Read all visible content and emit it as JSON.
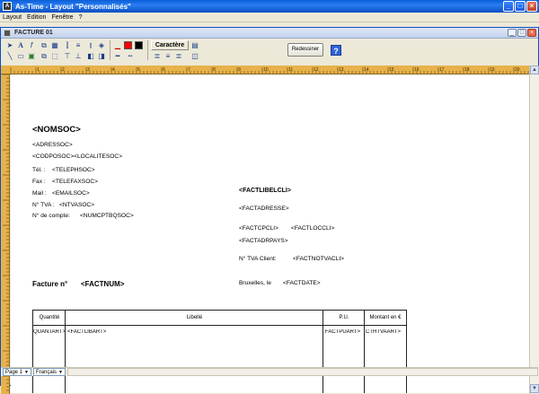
{
  "app": {
    "title": "As-Time - Layout \"Personnalisés\""
  },
  "menu": [
    "Layout",
    "Edition",
    "Fenêtre",
    "?"
  ],
  "child": {
    "title": "FACTURE 01"
  },
  "toolbar": {
    "caractere": "Caractère",
    "redessiner": "Redessiner",
    "help": "?"
  },
  "swatches": [
    "#ff0000",
    "#000000"
  ],
  "doc": {
    "nomsoc": "<NOMSOC>",
    "adressoc": "<ADRESSOC>",
    "codposoc": "<CODPOSOC><LOCALITESOC>",
    "tel_label": "Tél. :",
    "tel_value": "<TELEPHSOC>",
    "fax_label": "Fax :",
    "fax_value": "<TELEFAXSOC>",
    "mail_label": "Mail :",
    "mail_value": "<EMAILSOC>",
    "tva_label": "N° TVA :",
    "tva_value": "<NTVASOC>",
    "compte_label": "N° de compte:",
    "compte_value": "<NUMCPTBQSOC>",
    "factlibelcli": "<FACTLIBELCLI>",
    "factadresse": "<FACTADRESSE>",
    "factcpcli": "<FACTCPCLI>",
    "factloccli": "<FACTLOCCLI>",
    "factadrpays": "<FACTADRPAYS>",
    "tva_client_label": "N° TVA Client:",
    "tva_client_value": "<FACTNOTVACLI>",
    "facture_label": "Facture n°",
    "factnum": "<FACTNUM>",
    "date_label": "Bruxelles, le",
    "factdate": "<FACTDATE>",
    "table": {
      "headers": [
        "Quantité",
        "Libellé",
        "P.U.",
        "Montant en €"
      ],
      "row": [
        "QUANTART>",
        "<FACTLIBART>",
        "FACTPUART>",
        "CTHTVAART>"
      ]
    }
  },
  "status": {
    "page": "Page 1",
    "lang": "Français"
  }
}
